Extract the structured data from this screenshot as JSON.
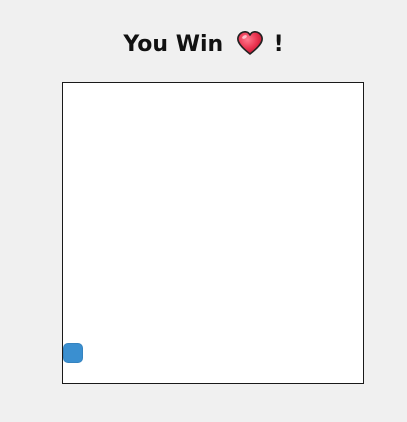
{
  "status": {
    "text_before": "You Win",
    "icon": "heart-icon",
    "text_after": "!"
  },
  "colors": {
    "background": "#f0f0f0",
    "board": "#ffffff",
    "player": "#3a8fd0",
    "heart": "#e8304c"
  }
}
